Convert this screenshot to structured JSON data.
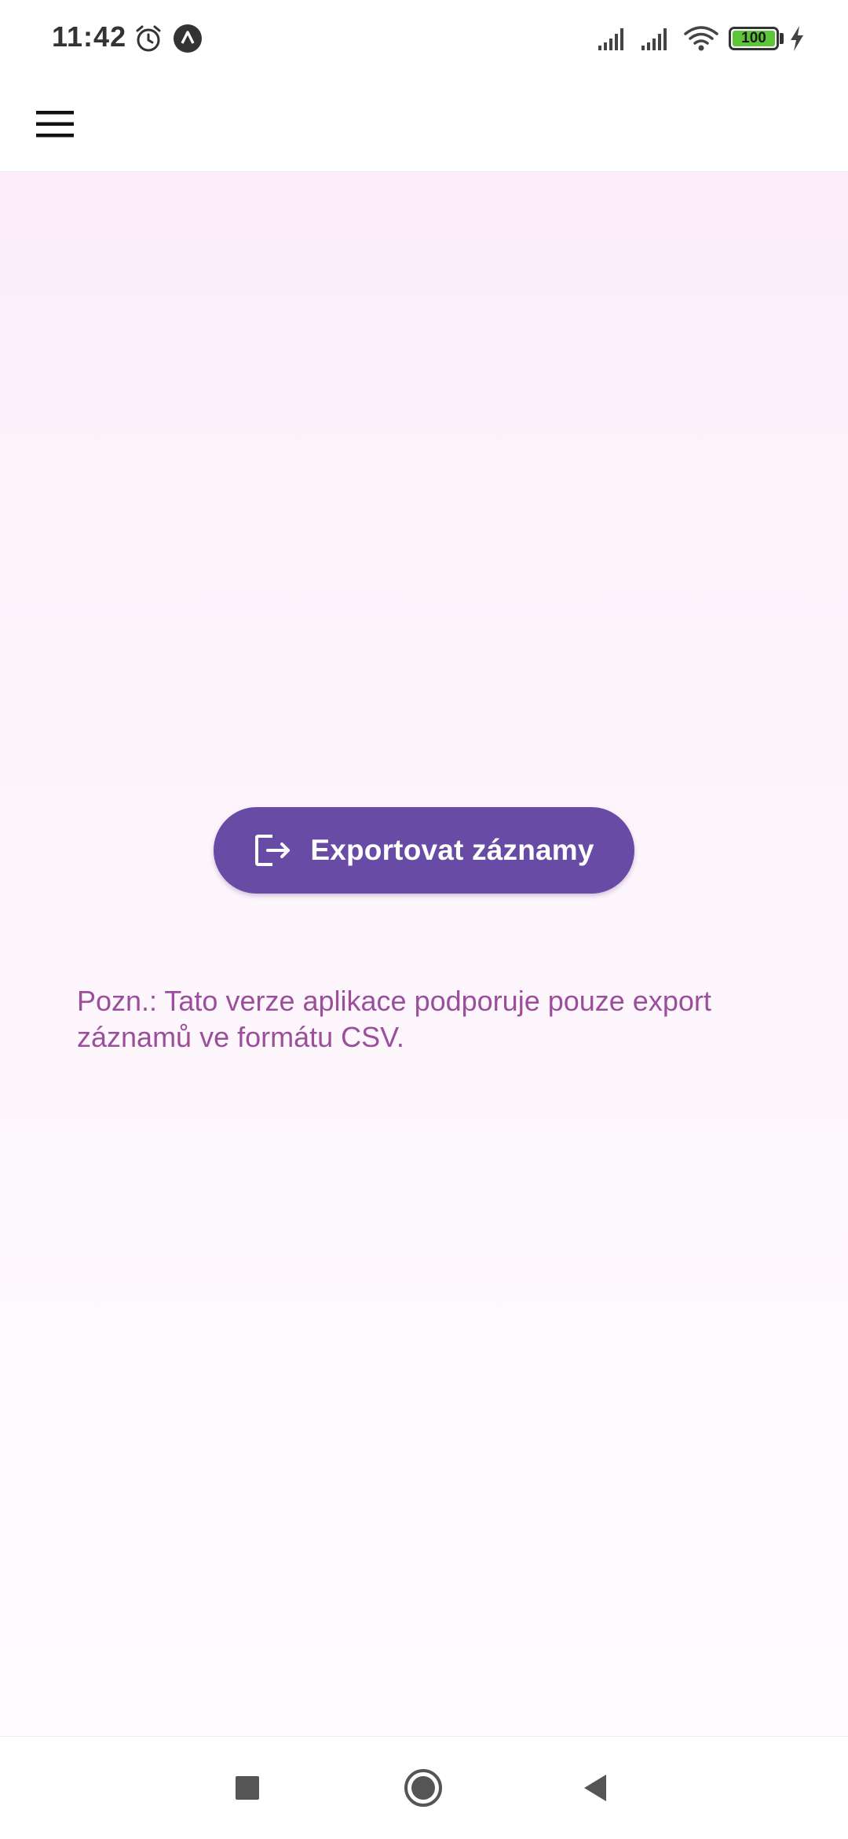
{
  "status_bar": {
    "time": "11:42",
    "battery_level": "100",
    "icons": [
      "alarm-icon",
      "notification-app-icon",
      "signal-icon",
      "signal-icon",
      "wifi-icon",
      "battery-icon",
      "charging-icon"
    ]
  },
  "app_bar": {
    "menu_icon": "hamburger-menu-icon"
  },
  "main": {
    "export_button_label": "Exportovat záznamy",
    "export_button_icon": "export-icon",
    "note": "Pozn.: Tato verze aplikace podporuje pouze export záznamů ve formátu CSV."
  },
  "nav_bar": {
    "buttons": [
      "recents-icon",
      "home-icon",
      "back-icon"
    ]
  },
  "colors": {
    "accent": "#674ba4",
    "note_text": "#9b4e9b",
    "background_top": "#fdeef9",
    "battery_fill": "#5ec43a"
  }
}
